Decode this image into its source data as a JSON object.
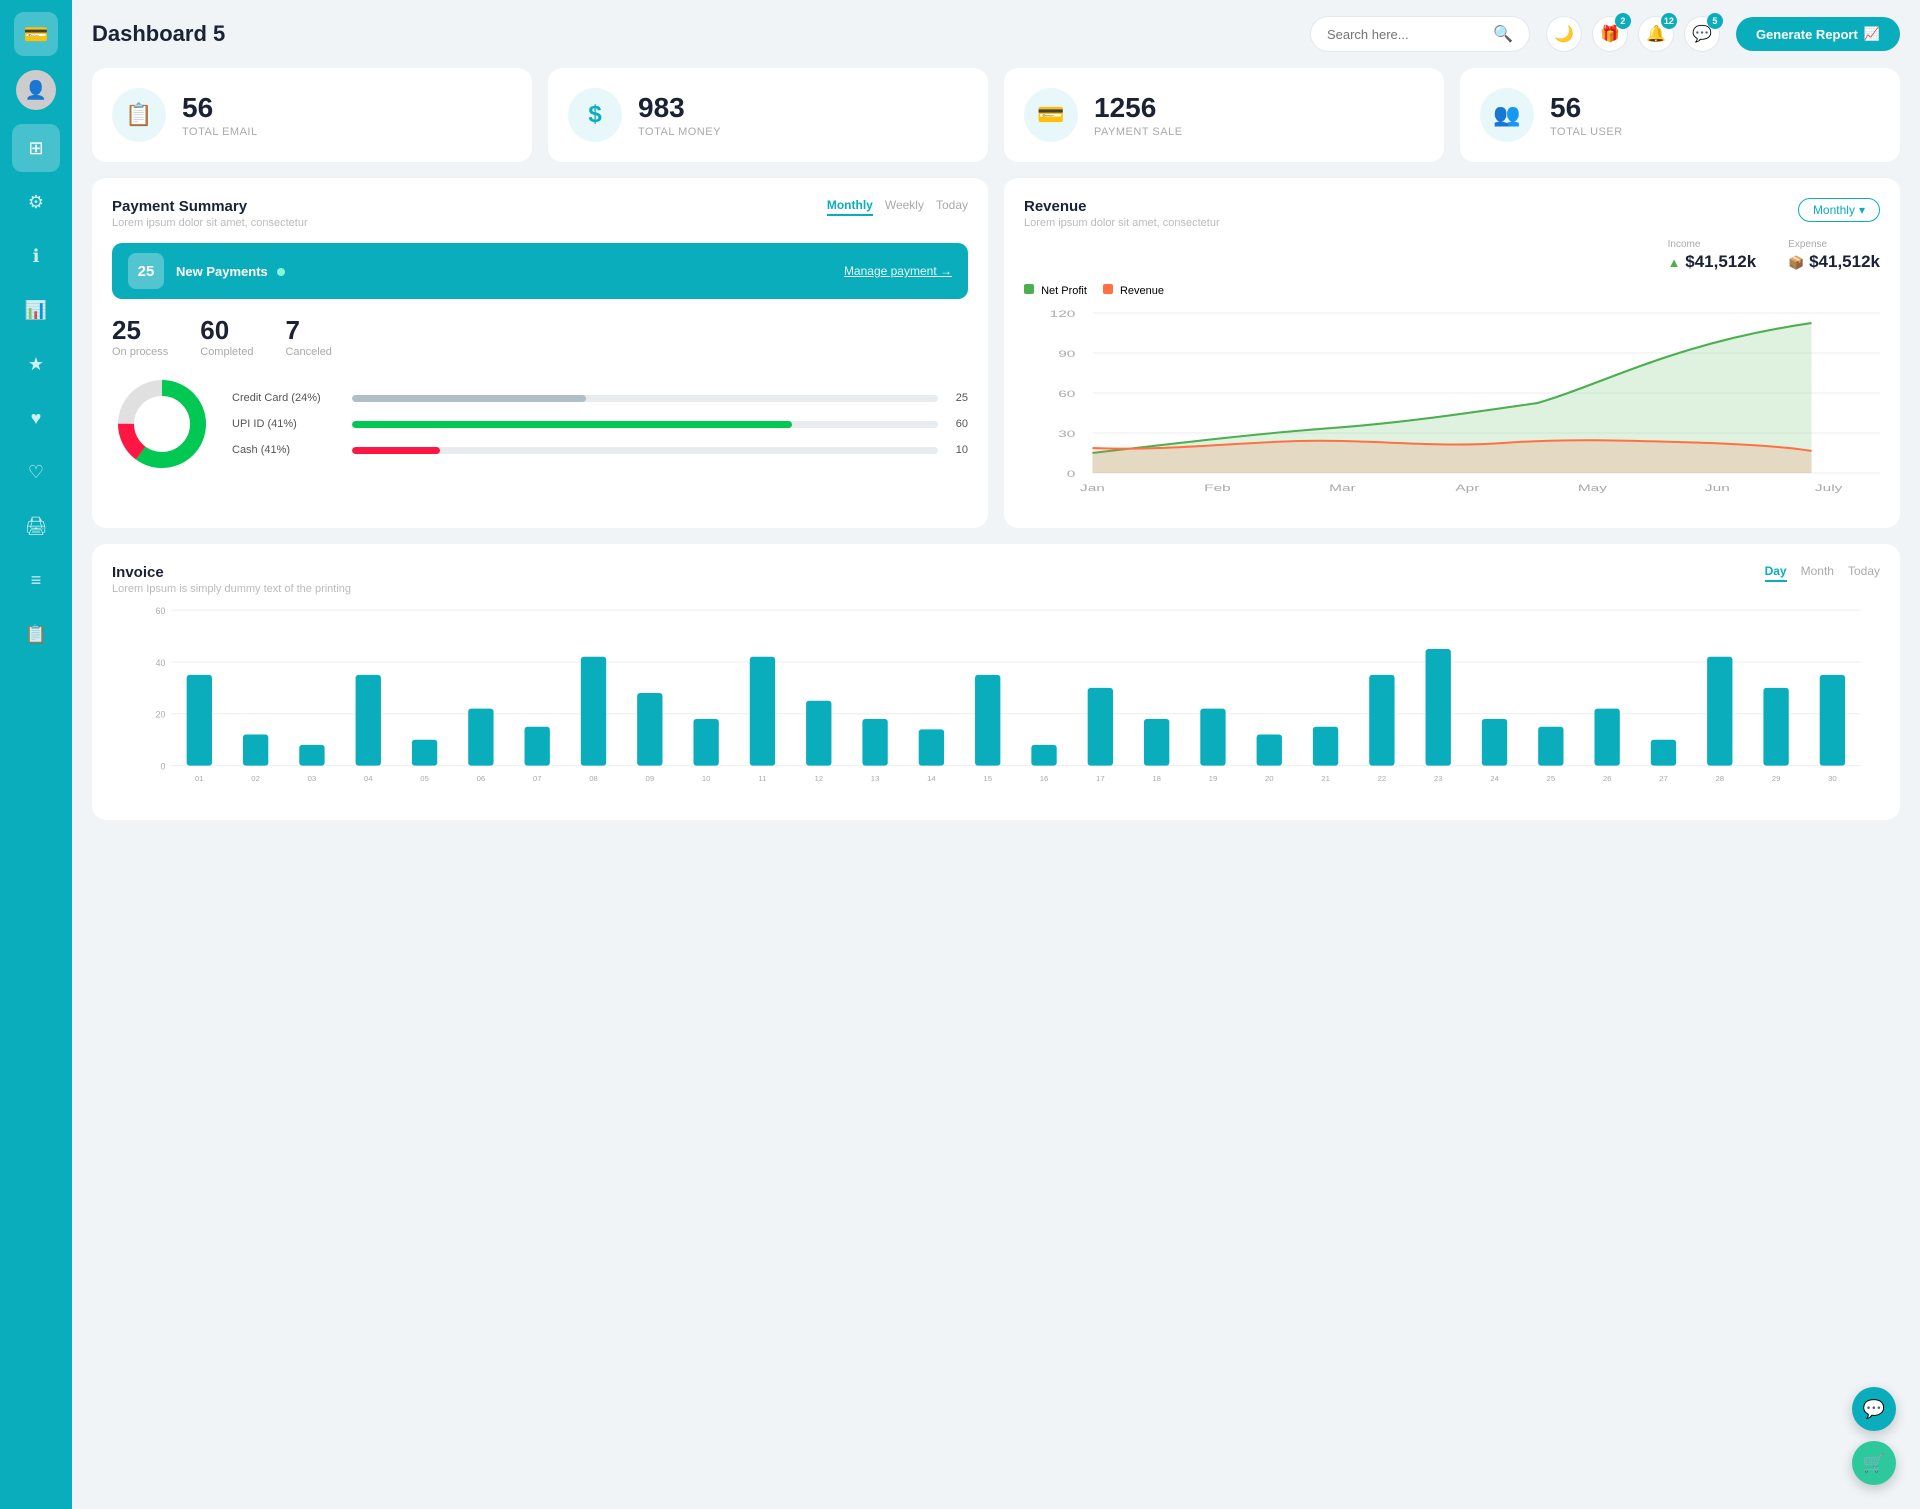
{
  "sidebar": {
    "logo_icon": "💳",
    "items": [
      {
        "id": "dashboard",
        "icon": "⊞",
        "active": true
      },
      {
        "id": "settings",
        "icon": "⚙"
      },
      {
        "id": "info",
        "icon": "ℹ"
      },
      {
        "id": "analytics",
        "icon": "📊"
      },
      {
        "id": "star",
        "icon": "★"
      },
      {
        "id": "heart",
        "icon": "♥"
      },
      {
        "id": "heart2",
        "icon": "♡"
      },
      {
        "id": "print",
        "icon": "🖨"
      },
      {
        "id": "list",
        "icon": "≡"
      },
      {
        "id": "clipboard",
        "icon": "📋"
      }
    ]
  },
  "header": {
    "title": "Dashboard 5",
    "search_placeholder": "Search here...",
    "badge_gift": "2",
    "badge_bell": "12",
    "badge_chat": "5",
    "generate_btn": "Generate Report"
  },
  "stat_cards": [
    {
      "id": "email",
      "icon": "📋",
      "value": "56",
      "label": "TOTAL EMAIL"
    },
    {
      "id": "money",
      "icon": "$",
      "value": "983",
      "label": "TOTAL MONEY"
    },
    {
      "id": "payment",
      "icon": "💳",
      "value": "1256",
      "label": "PAYMENT SALE"
    },
    {
      "id": "users",
      "icon": "👥",
      "value": "56",
      "label": "TOTAL USER"
    }
  ],
  "payment_summary": {
    "title": "Payment Summary",
    "subtitle": "Lorem ipsum dolor sit amet, consectetur",
    "tabs": [
      "Monthly",
      "Weekly",
      "Today"
    ],
    "active_tab": "Monthly",
    "new_payments_count": "25",
    "new_payments_label": "New Payments",
    "manage_link": "Manage payment →",
    "stats": [
      {
        "value": "25",
        "label": "On process"
      },
      {
        "value": "60",
        "label": "Completed"
      },
      {
        "value": "7",
        "label": "Canceled"
      }
    ],
    "progress_items": [
      {
        "label": "Credit Card (24%)",
        "value": 25,
        "color": "#b0bec5",
        "display": "25"
      },
      {
        "label": "UPI ID (41%)",
        "value": 60,
        "color": "#00c853",
        "display": "60"
      },
      {
        "label": "Cash (41%)",
        "value": 10,
        "color": "#ff1744",
        "display": "10"
      }
    ],
    "donut": {
      "segments": [
        {
          "color": "#00c853",
          "pct": 60
        },
        {
          "color": "#ff1744",
          "pct": 15
        },
        {
          "color": "#e0e0e0",
          "pct": 25
        }
      ]
    }
  },
  "revenue": {
    "title": "Revenue",
    "subtitle": "Lorem ipsum dolor sit amet, consectetur",
    "monthly_btn": "Monthly",
    "income_label": "Income",
    "income_value": "$41,512k",
    "expense_label": "Expense",
    "expense_value": "$41,512k",
    "legend": [
      {
        "label": "Net Profit",
        "color": "#4caf50"
      },
      {
        "label": "Revenue",
        "color": "#ff7043"
      }
    ],
    "x_labels": [
      "Jan",
      "Feb",
      "Mar",
      "Apr",
      "May",
      "Jun",
      "July"
    ],
    "y_labels": [
      "0",
      "30",
      "60",
      "90",
      "120"
    ]
  },
  "invoice": {
    "title": "Invoice",
    "subtitle": "Lorem Ipsum is simply dummy text of the printing",
    "tabs": [
      "Day",
      "Month",
      "Today"
    ],
    "active_tab": "Day",
    "y_labels": [
      "0",
      "20",
      "40",
      "60"
    ],
    "x_labels": [
      "01",
      "02",
      "03",
      "04",
      "05",
      "06",
      "07",
      "08",
      "09",
      "10",
      "11",
      "12",
      "13",
      "14",
      "15",
      "16",
      "17",
      "18",
      "19",
      "20",
      "21",
      "22",
      "23",
      "24",
      "25",
      "26",
      "27",
      "28",
      "29",
      "30"
    ],
    "bars": [
      35,
      12,
      8,
      35,
      10,
      22,
      15,
      42,
      28,
      18,
      42,
      25,
      18,
      14,
      35,
      8,
      30,
      18,
      22,
      12,
      15,
      35,
      45,
      18,
      15,
      22,
      10,
      42,
      30,
      35
    ]
  },
  "colors": {
    "teal": "#0AADBC",
    "green": "#00c853",
    "red": "#ff1744",
    "gray": "#b0bec5"
  }
}
